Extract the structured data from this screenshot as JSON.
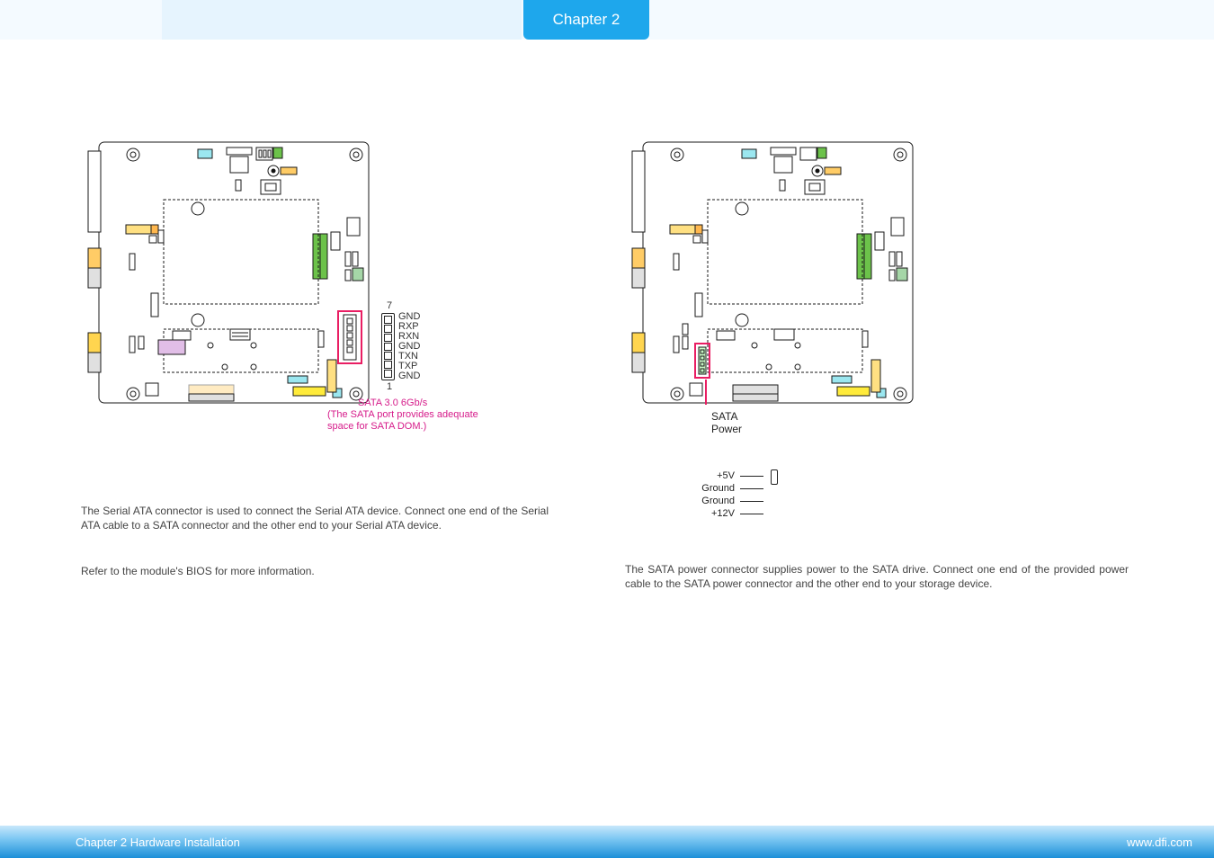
{
  "header": {
    "chapter_label": "Chapter 2"
  },
  "left": {
    "sata_port": {
      "pins_top": "7",
      "pins_bottom": "1",
      "pin_labels": [
        "GND",
        "RXP",
        "RXN",
        "GND",
        "TXN",
        "TXP",
        "GND"
      ],
      "caption_l1": "SATA 3.0 6Gb/s",
      "caption_l2": "(The SATA port provides adequate",
      "caption_l3": "space for SATA DOM.)"
    },
    "para1": "The Serial ATA connector is used to connect the Serial ATA device. Connect one end of the Serial ATA cable to a SATA connector and the other end to your Serial ATA device.",
    "para2": "Refer to the module's BIOS for more information."
  },
  "right": {
    "sata_power_label_l1": "SATA",
    "sata_power_label_l2": "Power",
    "power_pins": [
      {
        "label": "+5V",
        "end": "open"
      },
      {
        "label": "Ground",
        "end": "fill"
      },
      {
        "label": "Ground",
        "end": "fill"
      },
      {
        "label": "+12V",
        "end": "open"
      }
    ],
    "para": "The SATA power connector supplies power to the SATA drive. Connect one end of the provided power cable to the SATA power connector and the other end to your storage device."
  },
  "footer": {
    "left": "Chapter 2 Hardware Installation",
    "right": "www.dfi.com"
  }
}
